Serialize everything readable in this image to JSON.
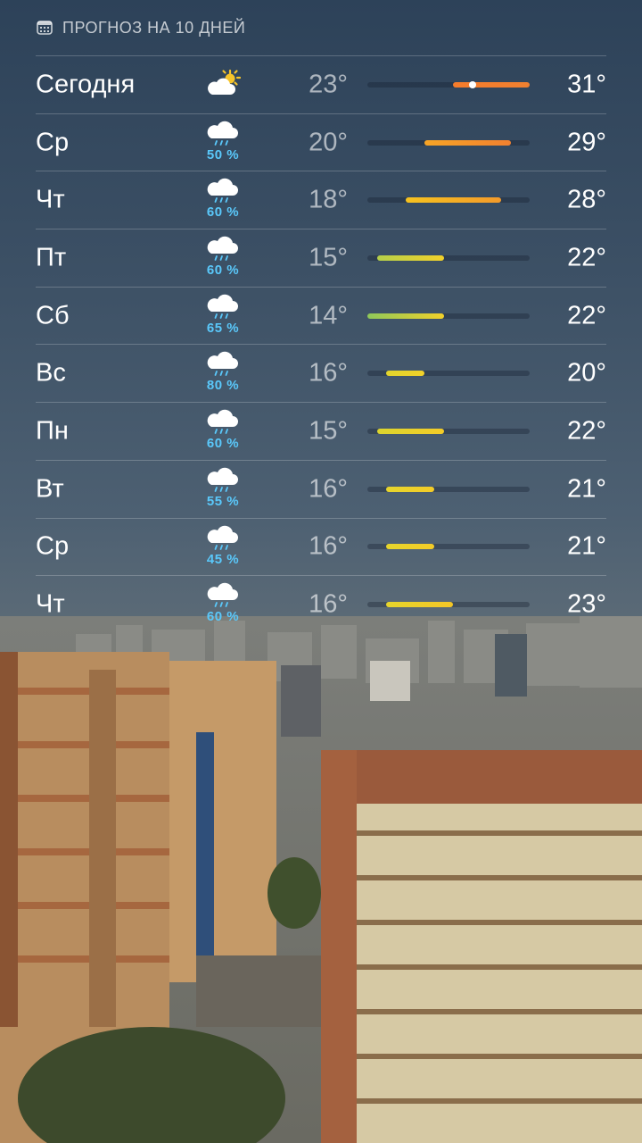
{
  "header": {
    "title": "ПРОГНОЗ НА 10 ДНЕЙ",
    "icon": "calendar-icon"
  },
  "scale": {
    "min": 14,
    "max": 31
  },
  "days": [
    {
      "day": "Сегодня",
      "icon": "sun-cloud-icon",
      "pop": "",
      "lo": "23°",
      "hi": "31°",
      "lo_val": 23,
      "hi_val": 31,
      "current_val": 25,
      "colors": [
        "#f57c2c",
        "#f08030"
      ]
    },
    {
      "day": "Ср",
      "icon": "rain-cloud-icon",
      "pop": "50 %",
      "lo": "20°",
      "hi": "29°",
      "lo_val": 20,
      "hi_val": 29,
      "colors": [
        "#f7a526",
        "#f1802f"
      ]
    },
    {
      "day": "Чт",
      "icon": "rain-cloud-icon",
      "pop": "60 %",
      "lo": "18°",
      "hi": "28°",
      "lo_val": 18,
      "hi_val": 28,
      "colors": [
        "#f6c21f",
        "#f39a2a"
      ]
    },
    {
      "day": "Пт",
      "icon": "rain-cloud-icon",
      "pop": "60 %",
      "lo": "15°",
      "hi": "22°",
      "lo_val": 15,
      "hi_val": 22,
      "colors": [
        "#b4cf4a",
        "#f2d12a"
      ]
    },
    {
      "day": "Сб",
      "icon": "rain-cloud-icon",
      "pop": "65 %",
      "lo": "14°",
      "hi": "22°",
      "lo_val": 14,
      "hi_val": 22,
      "colors": [
        "#8fc85a",
        "#f2d12a"
      ]
    },
    {
      "day": "Вс",
      "icon": "rain-cloud-icon",
      "pop": "80 %",
      "lo": "16°",
      "hi": "20°",
      "lo_val": 16,
      "hi_val": 20,
      "colors": [
        "#e3d52c",
        "#f2d12a"
      ]
    },
    {
      "day": "Пн",
      "icon": "rain-cloud-icon",
      "pop": "60 %",
      "lo": "15°",
      "hi": "22°",
      "lo_val": 15,
      "hi_val": 22,
      "colors": [
        "#dcd52e",
        "#f4cc28"
      ]
    },
    {
      "day": "Вт",
      "icon": "rain-cloud-icon",
      "pop": "55 %",
      "lo": "16°",
      "hi": "21°",
      "lo_val": 16,
      "hi_val": 21,
      "colors": [
        "#e6d52c",
        "#f4cc28"
      ]
    },
    {
      "day": "Ср",
      "icon": "rain-cloud-icon",
      "pop": "45 %",
      "lo": "16°",
      "hi": "21°",
      "lo_val": 16,
      "hi_val": 21,
      "colors": [
        "#e6d52c",
        "#f4cc28"
      ]
    },
    {
      "day": "Чт",
      "icon": "rain-cloud-icon",
      "pop": "60 %",
      "lo": "16°",
      "hi": "23°",
      "lo_val": 16,
      "hi_val": 23,
      "colors": [
        "#e6d52c",
        "#f4c626"
      ]
    }
  ]
}
